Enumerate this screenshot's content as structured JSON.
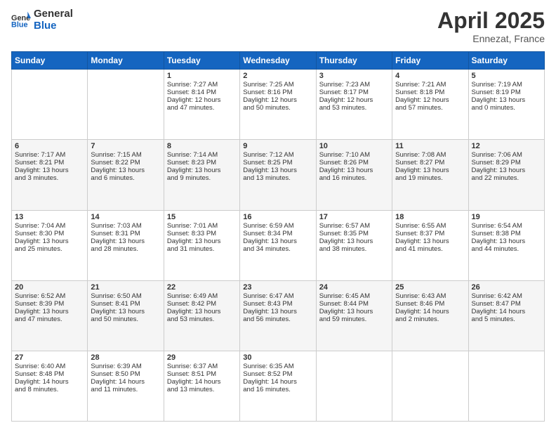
{
  "header": {
    "logo_general": "General",
    "logo_blue": "Blue",
    "title": "April 2025",
    "location": "Ennezat, France"
  },
  "days_of_week": [
    "Sunday",
    "Monday",
    "Tuesday",
    "Wednesday",
    "Thursday",
    "Friday",
    "Saturday"
  ],
  "weeks": [
    [
      {
        "day": "",
        "lines": []
      },
      {
        "day": "",
        "lines": []
      },
      {
        "day": "1",
        "lines": [
          "Sunrise: 7:27 AM",
          "Sunset: 8:14 PM",
          "Daylight: 12 hours",
          "and 47 minutes."
        ]
      },
      {
        "day": "2",
        "lines": [
          "Sunrise: 7:25 AM",
          "Sunset: 8:16 PM",
          "Daylight: 12 hours",
          "and 50 minutes."
        ]
      },
      {
        "day": "3",
        "lines": [
          "Sunrise: 7:23 AM",
          "Sunset: 8:17 PM",
          "Daylight: 12 hours",
          "and 53 minutes."
        ]
      },
      {
        "day": "4",
        "lines": [
          "Sunrise: 7:21 AM",
          "Sunset: 8:18 PM",
          "Daylight: 12 hours",
          "and 57 minutes."
        ]
      },
      {
        "day": "5",
        "lines": [
          "Sunrise: 7:19 AM",
          "Sunset: 8:19 PM",
          "Daylight: 13 hours",
          "and 0 minutes."
        ]
      }
    ],
    [
      {
        "day": "6",
        "lines": [
          "Sunrise: 7:17 AM",
          "Sunset: 8:21 PM",
          "Daylight: 13 hours",
          "and 3 minutes."
        ]
      },
      {
        "day": "7",
        "lines": [
          "Sunrise: 7:15 AM",
          "Sunset: 8:22 PM",
          "Daylight: 13 hours",
          "and 6 minutes."
        ]
      },
      {
        "day": "8",
        "lines": [
          "Sunrise: 7:14 AM",
          "Sunset: 8:23 PM",
          "Daylight: 13 hours",
          "and 9 minutes."
        ]
      },
      {
        "day": "9",
        "lines": [
          "Sunrise: 7:12 AM",
          "Sunset: 8:25 PM",
          "Daylight: 13 hours",
          "and 13 minutes."
        ]
      },
      {
        "day": "10",
        "lines": [
          "Sunrise: 7:10 AM",
          "Sunset: 8:26 PM",
          "Daylight: 13 hours",
          "and 16 minutes."
        ]
      },
      {
        "day": "11",
        "lines": [
          "Sunrise: 7:08 AM",
          "Sunset: 8:27 PM",
          "Daylight: 13 hours",
          "and 19 minutes."
        ]
      },
      {
        "day": "12",
        "lines": [
          "Sunrise: 7:06 AM",
          "Sunset: 8:29 PM",
          "Daylight: 13 hours",
          "and 22 minutes."
        ]
      }
    ],
    [
      {
        "day": "13",
        "lines": [
          "Sunrise: 7:04 AM",
          "Sunset: 8:30 PM",
          "Daylight: 13 hours",
          "and 25 minutes."
        ]
      },
      {
        "day": "14",
        "lines": [
          "Sunrise: 7:03 AM",
          "Sunset: 8:31 PM",
          "Daylight: 13 hours",
          "and 28 minutes."
        ]
      },
      {
        "day": "15",
        "lines": [
          "Sunrise: 7:01 AM",
          "Sunset: 8:33 PM",
          "Daylight: 13 hours",
          "and 31 minutes."
        ]
      },
      {
        "day": "16",
        "lines": [
          "Sunrise: 6:59 AM",
          "Sunset: 8:34 PM",
          "Daylight: 13 hours",
          "and 34 minutes."
        ]
      },
      {
        "day": "17",
        "lines": [
          "Sunrise: 6:57 AM",
          "Sunset: 8:35 PM",
          "Daylight: 13 hours",
          "and 38 minutes."
        ]
      },
      {
        "day": "18",
        "lines": [
          "Sunrise: 6:55 AM",
          "Sunset: 8:37 PM",
          "Daylight: 13 hours",
          "and 41 minutes."
        ]
      },
      {
        "day": "19",
        "lines": [
          "Sunrise: 6:54 AM",
          "Sunset: 8:38 PM",
          "Daylight: 13 hours",
          "and 44 minutes."
        ]
      }
    ],
    [
      {
        "day": "20",
        "lines": [
          "Sunrise: 6:52 AM",
          "Sunset: 8:39 PM",
          "Daylight: 13 hours",
          "and 47 minutes."
        ]
      },
      {
        "day": "21",
        "lines": [
          "Sunrise: 6:50 AM",
          "Sunset: 8:41 PM",
          "Daylight: 13 hours",
          "and 50 minutes."
        ]
      },
      {
        "day": "22",
        "lines": [
          "Sunrise: 6:49 AM",
          "Sunset: 8:42 PM",
          "Daylight: 13 hours",
          "and 53 minutes."
        ]
      },
      {
        "day": "23",
        "lines": [
          "Sunrise: 6:47 AM",
          "Sunset: 8:43 PM",
          "Daylight: 13 hours",
          "and 56 minutes."
        ]
      },
      {
        "day": "24",
        "lines": [
          "Sunrise: 6:45 AM",
          "Sunset: 8:44 PM",
          "Daylight: 13 hours",
          "and 59 minutes."
        ]
      },
      {
        "day": "25",
        "lines": [
          "Sunrise: 6:43 AM",
          "Sunset: 8:46 PM",
          "Daylight: 14 hours",
          "and 2 minutes."
        ]
      },
      {
        "day": "26",
        "lines": [
          "Sunrise: 6:42 AM",
          "Sunset: 8:47 PM",
          "Daylight: 14 hours",
          "and 5 minutes."
        ]
      }
    ],
    [
      {
        "day": "27",
        "lines": [
          "Sunrise: 6:40 AM",
          "Sunset: 8:48 PM",
          "Daylight: 14 hours",
          "and 8 minutes."
        ]
      },
      {
        "day": "28",
        "lines": [
          "Sunrise: 6:39 AM",
          "Sunset: 8:50 PM",
          "Daylight: 14 hours",
          "and 11 minutes."
        ]
      },
      {
        "day": "29",
        "lines": [
          "Sunrise: 6:37 AM",
          "Sunset: 8:51 PM",
          "Daylight: 14 hours",
          "and 13 minutes."
        ]
      },
      {
        "day": "30",
        "lines": [
          "Sunrise: 6:35 AM",
          "Sunset: 8:52 PM",
          "Daylight: 14 hours",
          "and 16 minutes."
        ]
      },
      {
        "day": "",
        "lines": []
      },
      {
        "day": "",
        "lines": []
      },
      {
        "day": "",
        "lines": []
      }
    ]
  ]
}
